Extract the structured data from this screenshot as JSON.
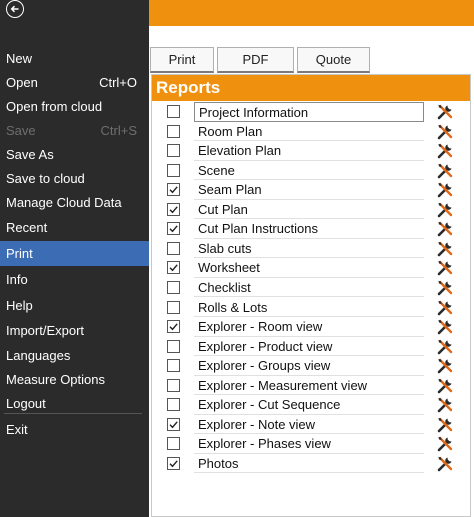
{
  "sidebar": {
    "back_icon": "back-arrow-icon",
    "items": [
      {
        "label": "New",
        "shortcut": "",
        "state": "normal"
      },
      {
        "label": "Open",
        "shortcut": "Ctrl+O",
        "state": "normal"
      },
      {
        "label": "Open from cloud",
        "shortcut": "",
        "state": "normal"
      },
      {
        "label": "Save",
        "shortcut": "Ctrl+S",
        "state": "disabled"
      },
      {
        "label": "Save As",
        "shortcut": "",
        "state": "normal"
      },
      {
        "label": "Save to cloud",
        "shortcut": "",
        "state": "normal"
      },
      {
        "label": "Manage Cloud Data",
        "shortcut": "",
        "state": "normal"
      },
      {
        "label": "Recent",
        "shortcut": "",
        "state": "normal"
      },
      {
        "label": "Print",
        "shortcut": "",
        "state": "selected"
      },
      {
        "label": "Info",
        "shortcut": "",
        "state": "normal"
      },
      {
        "label": "Help",
        "shortcut": "",
        "state": "normal"
      },
      {
        "label": "Import/Export",
        "shortcut": "",
        "state": "normal"
      },
      {
        "label": "Languages",
        "shortcut": "",
        "state": "normal"
      },
      {
        "label": "Measure Options",
        "shortcut": "",
        "state": "normal"
      },
      {
        "label": "Logout",
        "shortcut": "",
        "state": "normal"
      },
      {
        "label": "Exit",
        "shortcut": "",
        "state": "normal"
      }
    ]
  },
  "tabs": [
    {
      "label": "Print"
    },
    {
      "label": "PDF"
    },
    {
      "label": "Quote"
    }
  ],
  "reports": {
    "title": "Reports",
    "tool_icon": "wrench-screwdriver-icon",
    "items": [
      {
        "label": "Project Information",
        "checked": false
      },
      {
        "label": "Room Plan",
        "checked": false
      },
      {
        "label": "Elevation Plan",
        "checked": false
      },
      {
        "label": "Scene",
        "checked": false
      },
      {
        "label": "Seam Plan",
        "checked": true
      },
      {
        "label": "Cut Plan",
        "checked": true
      },
      {
        "label": "Cut Plan Instructions",
        "checked": true
      },
      {
        "label": "Slab cuts",
        "checked": false
      },
      {
        "label": "Worksheet",
        "checked": true
      },
      {
        "label": "Checklist",
        "checked": false
      },
      {
        "label": "Rolls & Lots",
        "checked": false
      },
      {
        "label": "Explorer - Room view",
        "checked": true
      },
      {
        "label": "Explorer - Product view",
        "checked": false
      },
      {
        "label": "Explorer - Groups view",
        "checked": false
      },
      {
        "label": "Explorer - Measurement view",
        "checked": false
      },
      {
        "label": "Explorer - Cut Sequence",
        "checked": false
      },
      {
        "label": "Explorer - Note view",
        "checked": true
      },
      {
        "label": "Explorer - Phases view",
        "checked": false
      },
      {
        "label": "Photos",
        "checked": true
      }
    ]
  },
  "colors": {
    "accent": "#f0900f",
    "selected": "#3c6cb4",
    "sidebar_bg": "#2b2b2b"
  }
}
